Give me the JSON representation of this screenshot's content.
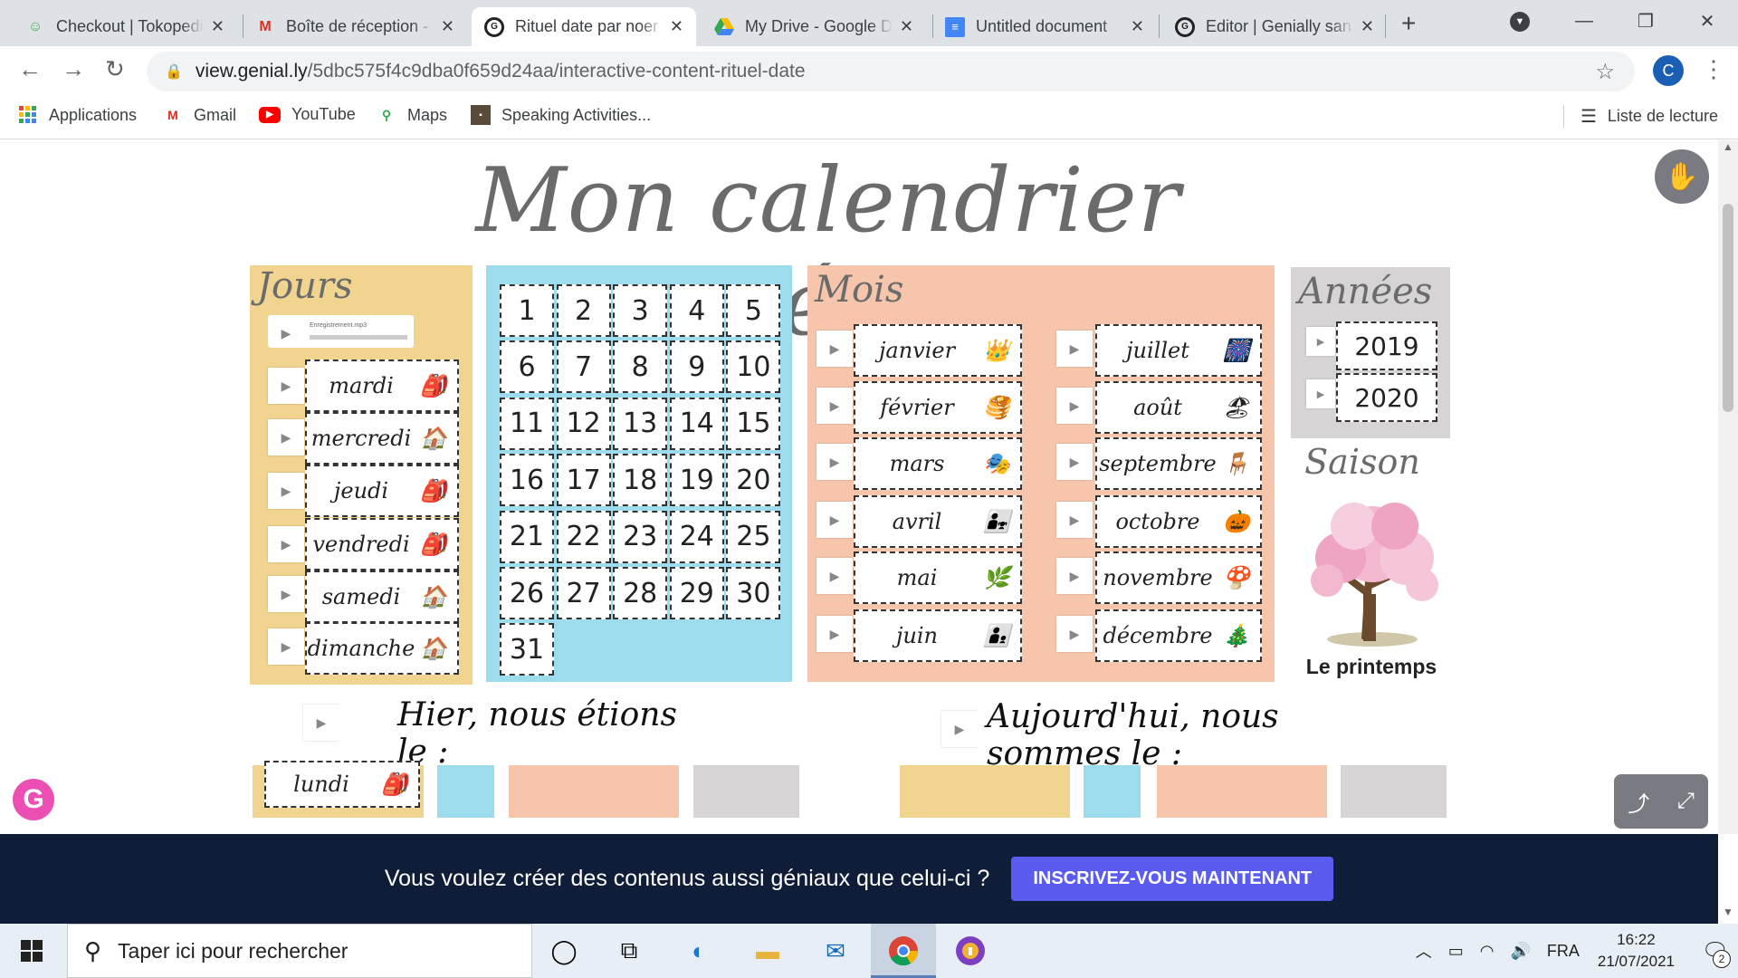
{
  "browser": {
    "tabs": [
      {
        "title": "Checkout | Tokopedia",
        "icon": "tokopedia-icon"
      },
      {
        "title": "Boîte de réception - Gmail",
        "icon": "gmail-icon"
      },
      {
        "title": "Rituel date par noer",
        "icon": "genially-icon",
        "active": true
      },
      {
        "title": "My Drive - Google Drive",
        "icon": "drive-icon"
      },
      {
        "title": "Untitled document",
        "icon": "docs-icon"
      },
      {
        "title": "Editor | Genially sans",
        "icon": "genially-icon"
      }
    ],
    "url_host": "view.genial.ly",
    "url_path": "/5dbc575f4c9dba0f659d24aa/interactive-content-rituel-date",
    "profile_initial": "C",
    "bookmarks": [
      {
        "label": "Applications",
        "icon": "apps-grid-icon"
      },
      {
        "label": "Gmail",
        "icon": "gmail-icon"
      },
      {
        "label": "YouTube",
        "icon": "youtube-icon"
      },
      {
        "label": "Maps",
        "icon": "maps-icon"
      },
      {
        "label": "Speaking Activities...",
        "icon": "bookmark-image-icon"
      }
    ],
    "reading_list": "Liste de lecture"
  },
  "page": {
    "title": "Mon calendrier numérique",
    "days_panel": {
      "title": "Jours",
      "audio_file": "Enregistrement.mp3",
      "days": [
        "mardi",
        "mercredi",
        "jeudi",
        "vendredi",
        "samedi",
        "dimanche"
      ]
    },
    "numbers": [
      "1",
      "2",
      "3",
      "4",
      "5",
      "6",
      "7",
      "8",
      "9",
      "10",
      "11",
      "12",
      "13",
      "14",
      "15",
      "16",
      "17",
      "18",
      "19",
      "20",
      "21",
      "22",
      "23",
      "24",
      "25",
      "26",
      "27",
      "28",
      "29",
      "30",
      "31"
    ],
    "months_panel": {
      "title": "Mois",
      "left": [
        "janvier",
        "février",
        "mars",
        "avril",
        "mai",
        "juin"
      ],
      "right": [
        "juillet",
        "août",
        "septembre",
        "octobre",
        "novembre",
        "décembre"
      ]
    },
    "years_panel": {
      "title": "Années",
      "years": [
        "2019",
        "2020"
      ]
    },
    "season": {
      "title": "Saison",
      "label": "Le printemps"
    },
    "yesterday_sentence": "Hier, nous étions le :",
    "today_sentence": "Aujourd'hui, nous sommes le :",
    "yesterday_day_card": "lundi"
  },
  "banner": {
    "text": "Vous voulez créer des contenus aussi géniaux que celui-ci ?",
    "button": "INSCRIVEZ-VOUS MAINTENANT"
  },
  "taskbar": {
    "search_placeholder": "Taper ici pour rechercher",
    "language": "FRA",
    "time": "16:22",
    "date": "21/07/2021",
    "notification_count": "2"
  },
  "colors": {
    "days_panel": "#f1d48f",
    "numbers_panel": "#9cdcec",
    "months_panel": "#f6c5ac",
    "years_panel": "#d6d4d4"
  }
}
